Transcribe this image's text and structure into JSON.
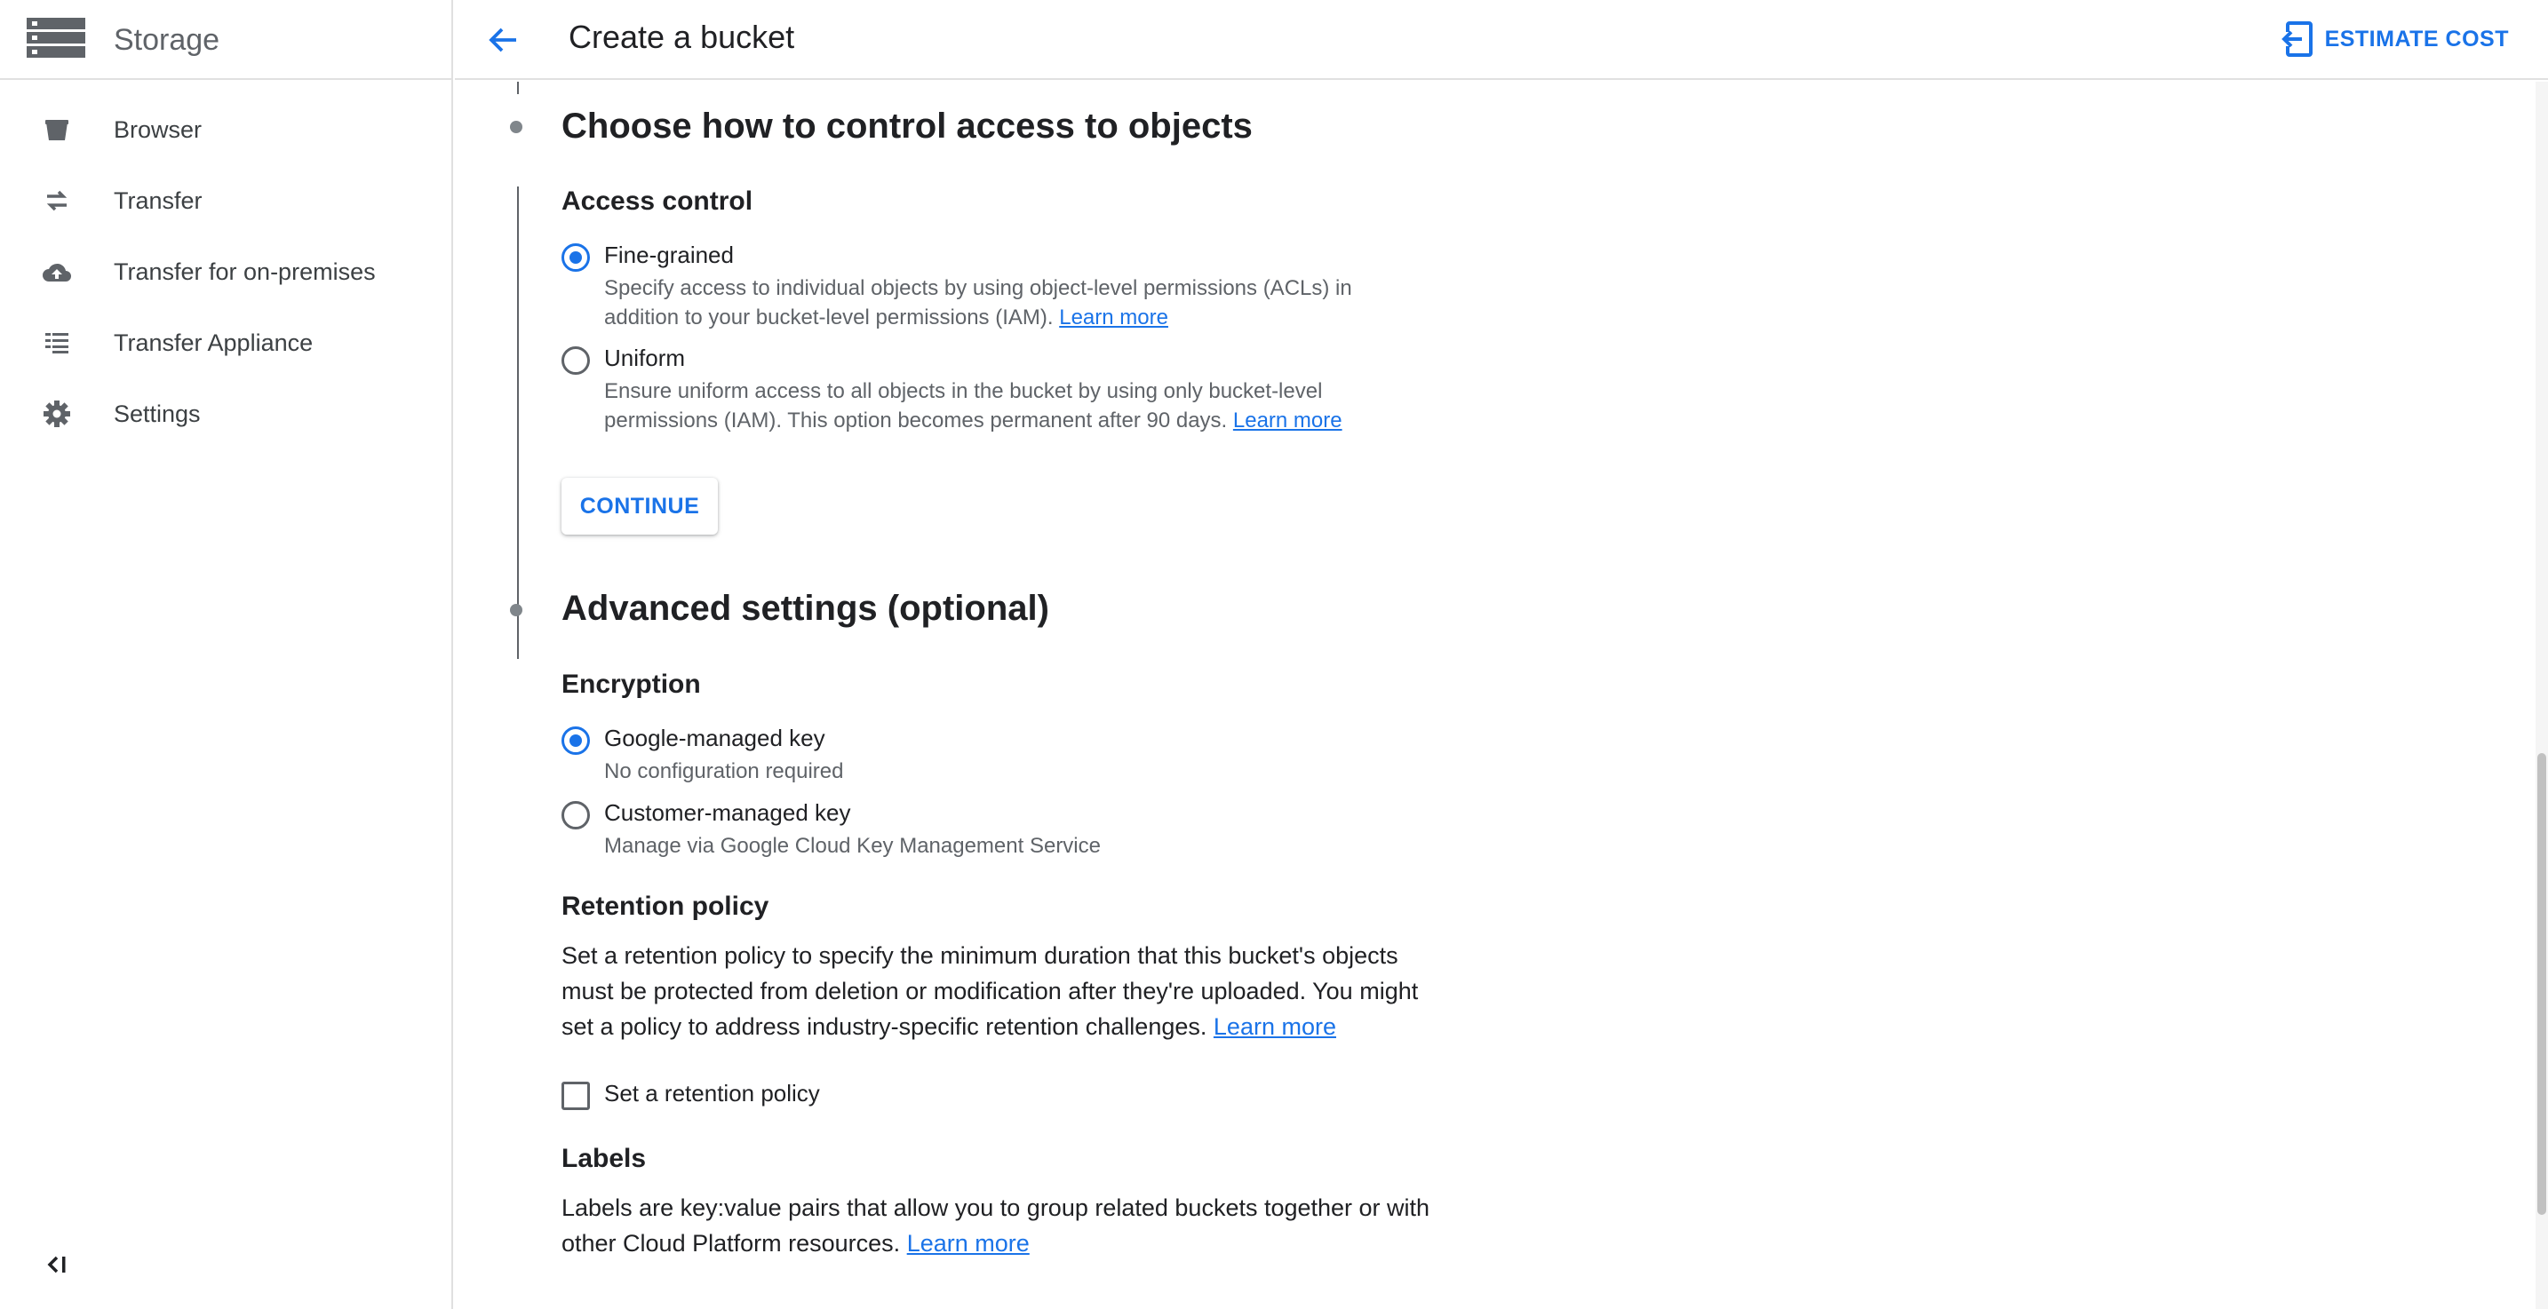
{
  "sidebar": {
    "title": "Storage",
    "items": [
      {
        "label": "Browser",
        "icon": "bucket-icon"
      },
      {
        "label": "Transfer",
        "icon": "swap-arrows-icon"
      },
      {
        "label": "Transfer for on-premises",
        "icon": "cloud-upload-icon"
      },
      {
        "label": "Transfer Appliance",
        "icon": "list-icon"
      },
      {
        "label": "Settings",
        "icon": "gear-icon"
      }
    ]
  },
  "topbar": {
    "title": "Create a bucket",
    "estimate_label": "ESTIMATE COST"
  },
  "access": {
    "heading": "Choose how to control access to objects",
    "subheading": "Access control",
    "options": [
      {
        "label": "Fine-grained",
        "selected": true,
        "desc_line1": "Specify access to individual objects by using object-level permissions (ACLs) in",
        "desc_line2": "addition to your bucket-level permissions (IAM).",
        "link": "Learn more"
      },
      {
        "label": "Uniform",
        "selected": false,
        "desc_line1": "Ensure uniform access to all objects in the bucket by using only bucket-level",
        "desc_line2": "permissions (IAM). This option becomes permanent after 90 days.",
        "link": "Learn more"
      }
    ],
    "continue_label": "CONTINUE"
  },
  "advanced": {
    "heading": "Advanced settings (optional)",
    "encryption": {
      "heading": "Encryption",
      "options": [
        {
          "label": "Google-managed key",
          "desc": "No configuration required",
          "selected": true
        },
        {
          "label": "Customer-managed key",
          "desc": "Manage via Google Cloud Key Management Service",
          "selected": false
        }
      ]
    },
    "retention": {
      "heading": "Retention policy",
      "line1": "Set a retention policy to specify the minimum duration that this bucket's objects",
      "line2": "must be protected from deletion or modification after they're uploaded. You might",
      "line3": "set a policy to address industry-specific retention challenges.",
      "link": "Learn more",
      "checkbox_label": "Set a retention policy",
      "checked": false
    },
    "labels": {
      "heading": "Labels",
      "line1": "Labels are key:value pairs that allow you to group related buckets together or with",
      "line2": "other Cloud Platform resources.",
      "link": "Learn more"
    }
  },
  "colors": {
    "accent": "#1a73e8",
    "text": "#202124",
    "muted": "#5f6368",
    "divider": "#e0e0e0"
  }
}
